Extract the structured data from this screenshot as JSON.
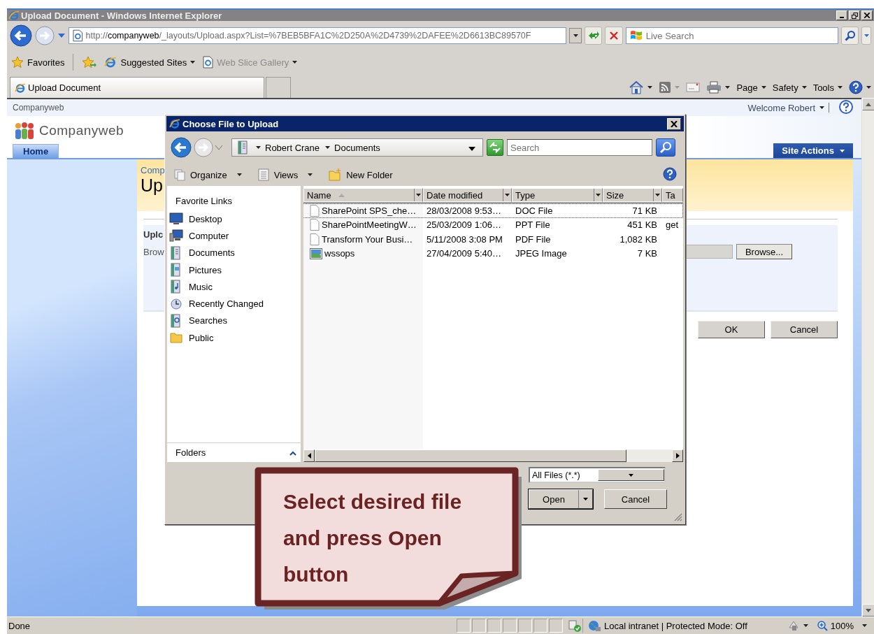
{
  "window": {
    "title": "Upload Document - Windows Internet Explorer"
  },
  "address_bar": {
    "scheme": "http://",
    "host": "companyweb",
    "path": "/_layouts/Upload.aspx?List=%7BEB5BFA1C%2D250A%2D4739%2DAFEE%2D6613BC89570F"
  },
  "search_box": {
    "placeholder": "Live Search"
  },
  "favorites_bar": {
    "favorites": "Favorites",
    "items": [
      {
        "label": "Suggested Sites",
        "disabled": false
      },
      {
        "label": "Web Slice Gallery",
        "disabled": true
      }
    ]
  },
  "tabs": [
    {
      "label": "Upload Document",
      "selected": true
    }
  ],
  "command_bar": {
    "items": [
      "Page",
      "Safety",
      "Tools"
    ]
  },
  "page": {
    "site_label": "Companyweb",
    "welcome": "Welcome Robert",
    "site_title": "Companyweb",
    "nav_tabs": [
      {
        "label": "Home",
        "selected": true
      }
    ],
    "site_actions": "Site Actions",
    "breadcrumb": "Comp",
    "heading": "Up",
    "section_title": "Uplc",
    "section_hint": "Brow",
    "browse_button": "Browse...",
    "buttons": [
      "OK",
      "Cancel"
    ]
  },
  "dialog": {
    "title": "Choose File to Upload",
    "path": [
      "Robert Crane",
      "Documents"
    ],
    "search": {
      "placeholder": "Search"
    },
    "toolbar": [
      {
        "label": "Organize",
        "kind": "menu"
      },
      {
        "label": "Views",
        "kind": "menu"
      },
      {
        "label": "New Folder",
        "kind": "button"
      }
    ],
    "favorite_links": {
      "heading": "Favorite Links",
      "items": [
        "Desktop",
        "Computer",
        "Documents",
        "Pictures",
        "Music",
        "Recently Changed",
        "Searches",
        "Public"
      ]
    },
    "folders_label": "Folders",
    "columns": [
      {
        "label": "Name",
        "sorted": true
      },
      {
        "label": "Date modified",
        "sorted": false
      },
      {
        "label": "Type",
        "sorted": false
      },
      {
        "label": "Size",
        "sorted": false
      },
      {
        "label": "Ta",
        "sorted": false
      }
    ],
    "files": [
      {
        "name": "SharePoint SPS_che…",
        "date": "28/03/2008 9:53…",
        "type": "DOC File",
        "size": "71 KB",
        "focused": true,
        "kind": "document"
      },
      {
        "name": "SharePointMeetingW…",
        "date": "25/03/2009 1:06…",
        "type": "PPT File",
        "size": "451 KB",
        "tags": "get",
        "focused": false,
        "kind": "document"
      },
      {
        "name": "Transform Your Busi…",
        "date": "5/11/2008 3:08 PM",
        "type": "PDF File",
        "size": "1,082 KB",
        "focused": false,
        "kind": "document"
      },
      {
        "name": "wssops",
        "date": "27/04/2009 5:40…",
        "type": "JPEG Image",
        "size": "7 KB",
        "focused": false,
        "kind": "image"
      }
    ],
    "file_type": "All Files (*.*)",
    "open_button": "Open",
    "cancel_button": "Cancel"
  },
  "callout": {
    "text": "Select desired file and press Open button"
  },
  "status_bar": {
    "status": "Done",
    "zone": "Local intranet | Protected Mode: Off",
    "zoom": "100%"
  }
}
